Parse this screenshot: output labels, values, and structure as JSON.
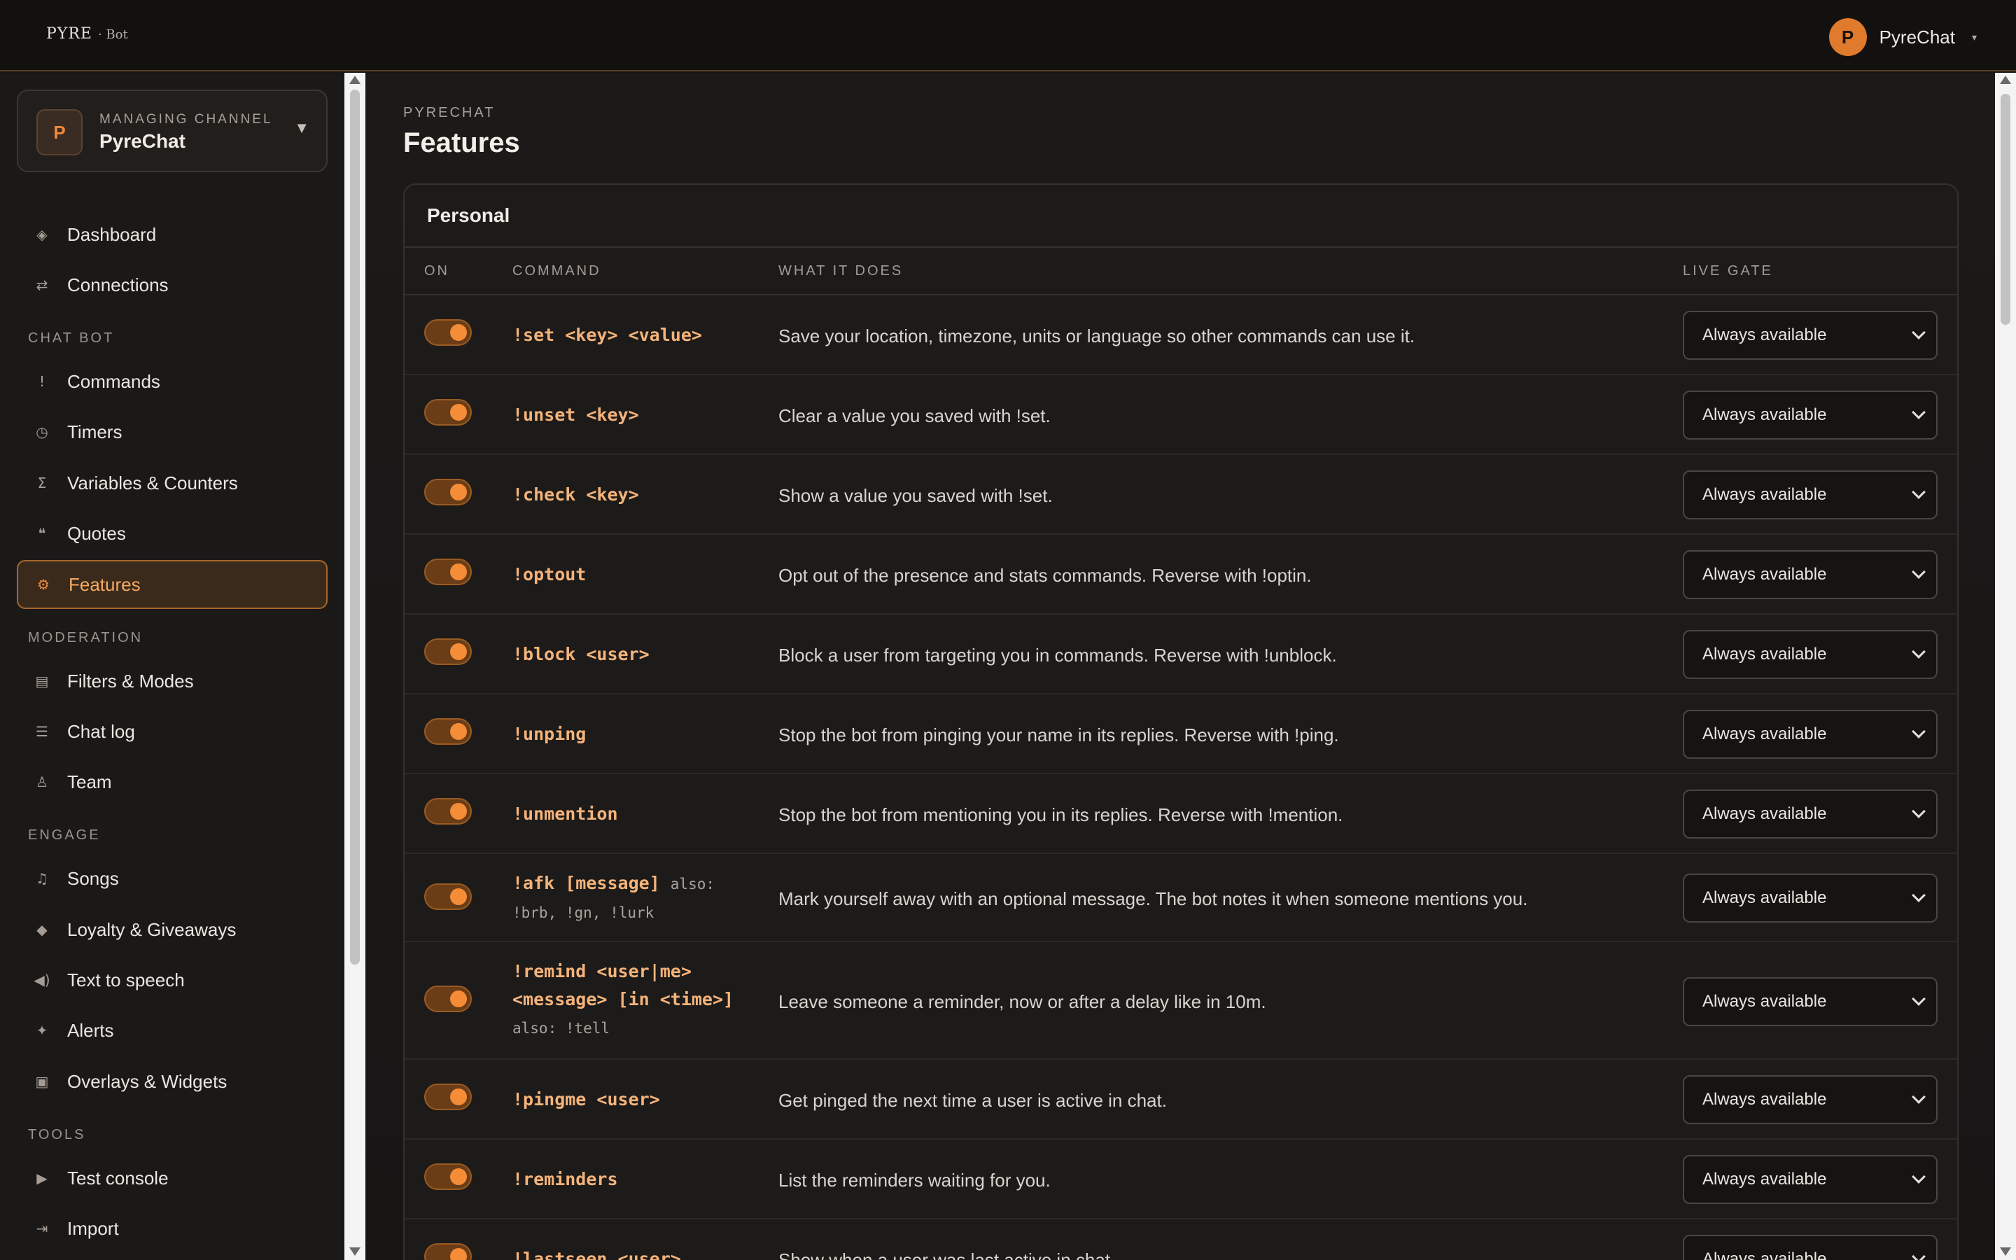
{
  "app": {
    "logo_text": "PYRE",
    "logo_sub": "· Bot",
    "user_initial": "P",
    "user_name": "PyreChat",
    "accent": "#e07a2c"
  },
  "sidebar": {
    "channel_label": "MANAGING CHANNEL",
    "channel_name": "PyreChat",
    "channel_initial": "P",
    "items": [
      {
        "label": "Dashboard",
        "icon": "diamond-icon",
        "glyph": "◈"
      },
      {
        "label": "Connections",
        "icon": "swap-icon",
        "glyph": "⇄"
      },
      {
        "label": "Commands",
        "icon": "exclamation-icon",
        "glyph": "!"
      },
      {
        "label": "Timers",
        "icon": "clock-icon",
        "glyph": "◷"
      },
      {
        "label": "Variables & Counters",
        "icon": "sigma-icon",
        "glyph": "Σ"
      },
      {
        "label": "Quotes",
        "icon": "quote-icon",
        "glyph": "❝"
      },
      {
        "label": "Features",
        "icon": "gear-icon",
        "glyph": "⚙",
        "active": true
      },
      {
        "label": "Filters & Modes",
        "icon": "filter-list-icon",
        "glyph": "▤"
      },
      {
        "label": "Chat log",
        "icon": "list-icon",
        "glyph": "☰"
      },
      {
        "label": "Team",
        "icon": "person-icon",
        "glyph": "♙"
      },
      {
        "label": "Songs",
        "icon": "music-note-icon",
        "glyph": "♫"
      },
      {
        "label": "Loyalty & Giveaways",
        "icon": "diamond-small-icon",
        "glyph": "◆"
      },
      {
        "label": "Text to speech",
        "icon": "speaker-icon",
        "glyph": "🔊"
      },
      {
        "label": "Alerts",
        "icon": "sparkle-icon",
        "glyph": "✦"
      },
      {
        "label": "Overlays & Widgets",
        "icon": "widget-icon",
        "glyph": "▣"
      },
      {
        "label": "Test console",
        "icon": "play-icon",
        "glyph": "▶"
      },
      {
        "label": "Import",
        "icon": "import-icon",
        "glyph": "⇥"
      }
    ],
    "sections": {
      "chat_bot": "CHAT BOT",
      "moderation": "MODERATION",
      "engage": "ENGAGE",
      "tools": "TOOLS"
    }
  },
  "main": {
    "breadcrumb": "PYRECHAT",
    "title": "Features",
    "panel_title": "Personal",
    "columns": {
      "on": "ON",
      "command": "COMMAND",
      "what": "WHAT IT DOES",
      "gate": "LIVE GATE"
    },
    "rows": [
      {
        "cmd": "!set <key> <value>",
        "desc": "Save your location, timezone, units or language so other commands can use it.",
        "gate": "Always available"
      },
      {
        "cmd": "!unset <key>",
        "desc": "Clear a value you saved with !set.",
        "gate": "Always available"
      },
      {
        "cmd": "!check <key>",
        "desc": "Show a value you saved with !set.",
        "gate": "Always available"
      },
      {
        "cmd": "!optout",
        "desc": "Opt out of the presence and stats commands. Reverse with !optin.",
        "gate": "Always available"
      },
      {
        "cmd": "!block <user>",
        "desc": "Block a user from targeting you in commands. Reverse with !unblock.",
        "gate": "Always available"
      },
      {
        "cmd": "!unping",
        "desc": "Stop the bot from pinging your name in its replies. Reverse with !ping.",
        "gate": "Always available"
      },
      {
        "cmd": "!unmention",
        "desc": "Stop the bot from mentioning you in its replies. Reverse with !mention.",
        "gate": "Always available"
      },
      {
        "cmd": "!afk [message]",
        "also_inline": "also:",
        "also": "!brb, !gn, !lurk",
        "desc": "Mark yourself away with an optional message. The bot notes it when someone mentions you.",
        "gate": "Always available"
      },
      {
        "cmd_line1": "!remind <user|me>",
        "cmd_line2": "<message> [in <time>]",
        "also": "also: !tell",
        "desc": "Leave someone a reminder, now or after a delay like in 10m.",
        "gate": "Always available"
      },
      {
        "cmd": "!pingme <user>",
        "desc": "Get pinged the next time a user is active in chat.",
        "gate": "Always available"
      },
      {
        "cmd": "!reminders",
        "desc": "List the reminders waiting for you.",
        "gate": "Always available"
      },
      {
        "cmd": "!lastseen <user>",
        "desc": "Show when a user was last active in chat.",
        "gate": "Always available"
      }
    ]
  }
}
